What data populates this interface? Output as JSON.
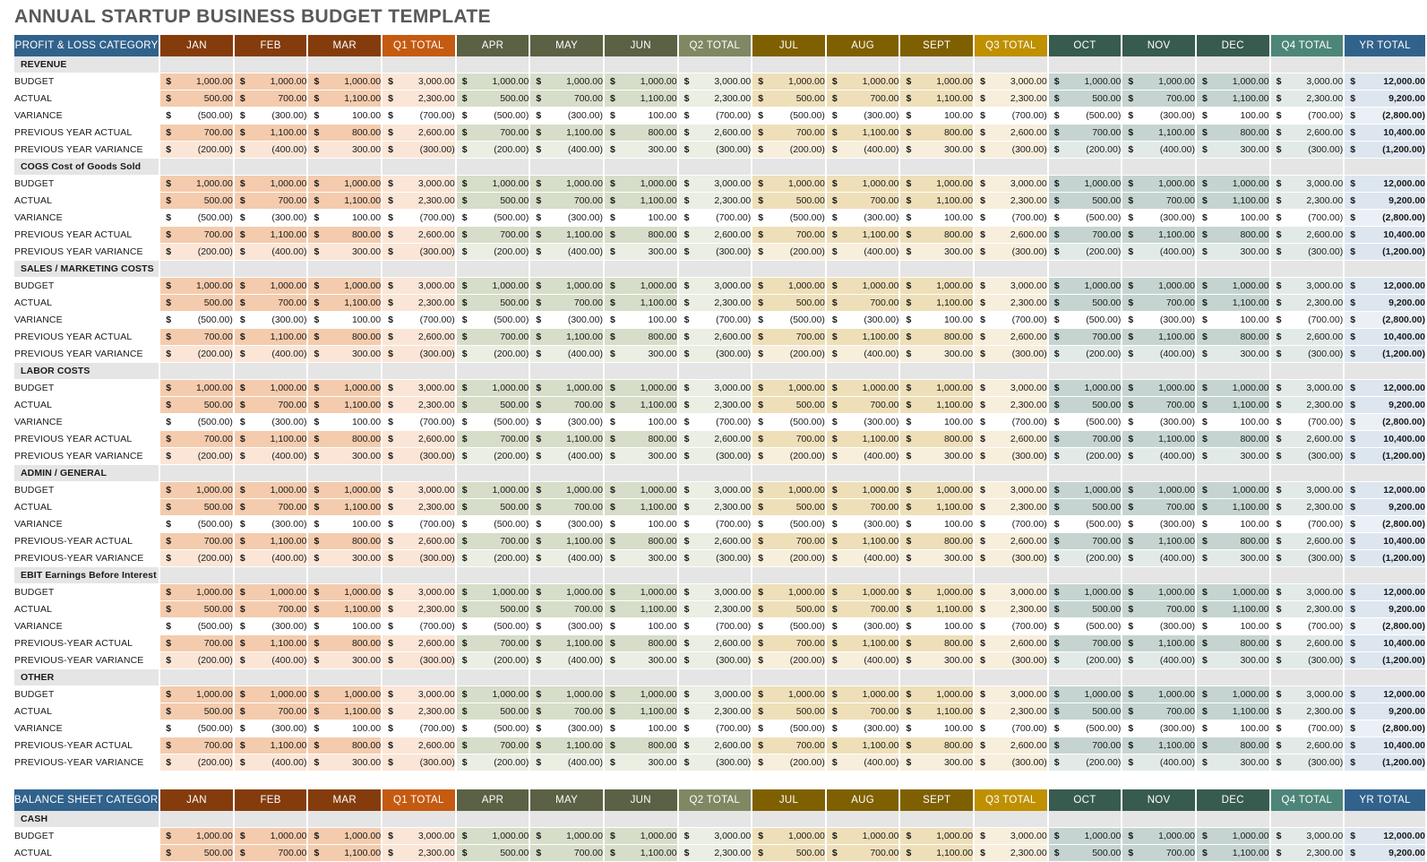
{
  "title": "ANNUAL STARTUP BUSINESS BUDGET TEMPLATE",
  "columns": [
    {
      "key": "cat",
      "label": "PROFIT & LOSS CATEGORY",
      "group": "cat"
    },
    {
      "key": "jan",
      "label": "JAN",
      "group": "q1"
    },
    {
      "key": "feb",
      "label": "FEB",
      "group": "q1"
    },
    {
      "key": "mar",
      "label": "MAR",
      "group": "q1"
    },
    {
      "key": "q1",
      "label": "Q1 TOTAL",
      "group": "q1t"
    },
    {
      "key": "apr",
      "label": "APR",
      "group": "q2"
    },
    {
      "key": "may",
      "label": "MAY",
      "group": "q2"
    },
    {
      "key": "jun",
      "label": "JUN",
      "group": "q2"
    },
    {
      "key": "q2",
      "label": "Q2 TOTAL",
      "group": "q2t"
    },
    {
      "key": "jul",
      "label": "JUL",
      "group": "q3"
    },
    {
      "key": "aug",
      "label": "AUG",
      "group": "q3"
    },
    {
      "key": "sept",
      "label": "SEPT",
      "group": "q3"
    },
    {
      "key": "q3",
      "label": "Q3 TOTAL",
      "group": "q3t"
    },
    {
      "key": "oct",
      "label": "OCT",
      "group": "q4"
    },
    {
      "key": "nov",
      "label": "NOV",
      "group": "q4"
    },
    {
      "key": "dec",
      "label": "DEC",
      "group": "q4"
    },
    {
      "key": "q4",
      "label": "Q4 TOTAL",
      "group": "q4t"
    },
    {
      "key": "yr",
      "label": "YR TOTAL",
      "group": "yr"
    }
  ],
  "balance_header_label": "BALANCE SHEET CATEGORY",
  "currency_symbol": "$",
  "row_values": {
    "budget": [
      "1,000.00",
      "1,000.00",
      "1,000.00",
      "3,000.00",
      "1,000.00",
      "1,000.00",
      "1,000.00",
      "3,000.00",
      "1,000.00",
      "1,000.00",
      "1,000.00",
      "3,000.00",
      "1,000.00",
      "1,000.00",
      "1,000.00",
      "3,000.00",
      "12,000.00"
    ],
    "actual": [
      "500.00",
      "700.00",
      "1,100.00",
      "2,300.00",
      "500.00",
      "700.00",
      "1,100.00",
      "2,300.00",
      "500.00",
      "700.00",
      "1,100.00",
      "2,300.00",
      "500.00",
      "700.00",
      "1,100.00",
      "2,300.00",
      "9,200.00"
    ],
    "variance": [
      "(500.00)",
      "(300.00)",
      "100.00",
      "(700.00)",
      "(500.00)",
      "(300.00)",
      "100.00",
      "(700.00)",
      "(500.00)",
      "(300.00)",
      "100.00",
      "(700.00)",
      "(500.00)",
      "(300.00)",
      "100.00",
      "(700.00)",
      "(2,800.00)"
    ],
    "prev_actual": [
      "700.00",
      "1,100.00",
      "800.00",
      "2,600.00",
      "700.00",
      "1,100.00",
      "800.00",
      "2,600.00",
      "700.00",
      "1,100.00",
      "800.00",
      "2,600.00",
      "700.00",
      "1,100.00",
      "800.00",
      "2,600.00",
      "10,400.00"
    ],
    "prev_variance": [
      "(200.00)",
      "(400.00)",
      "300.00",
      "(300.00)",
      "(200.00)",
      "(400.00)",
      "300.00",
      "(300.00)",
      "(200.00)",
      "(400.00)",
      "300.00",
      "(300.00)",
      "(200.00)",
      "(400.00)",
      "300.00",
      "(300.00)",
      "(1,200.00)"
    ]
  },
  "profit_loss_sections": [
    {
      "name": "REVENUE",
      "rows": [
        {
          "label": "BUDGET",
          "values": "budget",
          "style": "a"
        },
        {
          "label": "ACTUAL",
          "values": "actual",
          "style": "a"
        },
        {
          "label": "VARIANCE",
          "values": "variance",
          "style": "white"
        },
        {
          "label": "PREVIOUS YEAR ACTUAL",
          "values": "prev_actual",
          "style": "a"
        },
        {
          "label": "PREVIOUS YEAR VARIANCE",
          "values": "prev_variance",
          "style": "b"
        }
      ]
    },
    {
      "name": "COGS Cost of Goods Sold",
      "rows": [
        {
          "label": "BUDGET",
          "values": "budget",
          "style": "a"
        },
        {
          "label": "ACTUAL",
          "values": "actual",
          "style": "a"
        },
        {
          "label": "VARIANCE",
          "values": "variance",
          "style": "white"
        },
        {
          "label": "PREVIOUS YEAR ACTUAL",
          "values": "prev_actual",
          "style": "a"
        },
        {
          "label": "PREVIOUS YEAR VARIANCE",
          "values": "prev_variance",
          "style": "b"
        }
      ]
    },
    {
      "name": "SALES / MARKETING COSTS",
      "rows": [
        {
          "label": "BUDGET",
          "values": "budget",
          "style": "a"
        },
        {
          "label": "ACTUAL",
          "values": "actual",
          "style": "a"
        },
        {
          "label": "VARIANCE",
          "values": "variance",
          "style": "white"
        },
        {
          "label": "PREVIOUS YEAR ACTUAL",
          "values": "prev_actual",
          "style": "a"
        },
        {
          "label": "PREVIOUS YEAR VARIANCE",
          "values": "prev_variance",
          "style": "b"
        }
      ]
    },
    {
      "name": "LABOR COSTS",
      "rows": [
        {
          "label": "BUDGET",
          "values": "budget",
          "style": "a"
        },
        {
          "label": "ACTUAL",
          "values": "actual",
          "style": "a"
        },
        {
          "label": "VARIANCE",
          "values": "variance",
          "style": "white"
        },
        {
          "label": "PREVIOUS YEAR ACTUAL",
          "values": "prev_actual",
          "style": "a"
        },
        {
          "label": "PREVIOUS YEAR VARIANCE",
          "values": "prev_variance",
          "style": "b"
        }
      ]
    },
    {
      "name": "ADMIN / GENERAL",
      "rows": [
        {
          "label": "BUDGET",
          "values": "budget",
          "style": "a"
        },
        {
          "label": "ACTUAL",
          "values": "actual",
          "style": "a"
        },
        {
          "label": "VARIANCE",
          "values": "variance",
          "style": "white"
        },
        {
          "label": "PREVIOUS-YEAR ACTUAL",
          "values": "prev_actual",
          "style": "a"
        },
        {
          "label": "PREVIOUS-YEAR VARIANCE",
          "values": "prev_variance",
          "style": "b"
        }
      ]
    },
    {
      "name": "EBIT Earnings Before Interest & Taxes",
      "rows": [
        {
          "label": "BUDGET",
          "values": "budget",
          "style": "a"
        },
        {
          "label": "ACTUAL",
          "values": "actual",
          "style": "a"
        },
        {
          "label": "VARIANCE",
          "values": "variance",
          "style": "white"
        },
        {
          "label": "PREVIOUS-YEAR ACTUAL",
          "values": "prev_actual",
          "style": "a"
        },
        {
          "label": "PREVIOUS-YEAR VARIANCE",
          "values": "prev_variance",
          "style": "b"
        }
      ]
    },
    {
      "name": "OTHER",
      "rows": [
        {
          "label": "BUDGET",
          "values": "budget",
          "style": "a"
        },
        {
          "label": "ACTUAL",
          "values": "actual",
          "style": "a"
        },
        {
          "label": "VARIANCE",
          "values": "variance",
          "style": "white"
        },
        {
          "label": "PREVIOUS-YEAR ACTUAL",
          "values": "prev_actual",
          "style": "a"
        },
        {
          "label": "PREVIOUS-YEAR VARIANCE",
          "values": "prev_variance",
          "style": "b"
        }
      ]
    }
  ],
  "balance_sheet_sections": [
    {
      "name": "CASH",
      "rows": [
        {
          "label": "BUDGET",
          "values": "budget",
          "style": "a"
        },
        {
          "label": "ACTUAL",
          "values": "actual",
          "style": "a"
        }
      ]
    }
  ]
}
